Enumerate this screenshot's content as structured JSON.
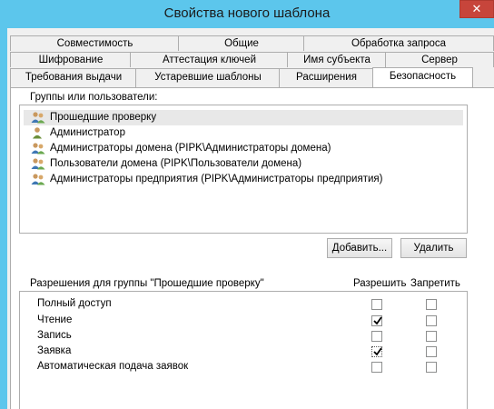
{
  "window": {
    "title": "Свойства нового шаблона",
    "close_glyph": "✕"
  },
  "tabs": {
    "row1": [
      "Совместимость",
      "Общие",
      "Обработка запроса"
    ],
    "row2": [
      "Шифрование",
      "Аттестация ключей",
      "Имя субъекта",
      "Сервер"
    ],
    "row3": [
      "Требования выдачи",
      "Устаревшие шаблоны",
      "Расширения",
      "Безопасность"
    ],
    "active": "Безопасность"
  },
  "groups": {
    "label": "Группы или пользователи:",
    "items": [
      {
        "name": "Прошедшие проверку",
        "icon": "user-group-icon",
        "selected": true
      },
      {
        "name": "Администратор",
        "icon": "user-icon",
        "selected": false
      },
      {
        "name": "Администраторы домена (PIPK\\Администраторы домена)",
        "icon": "user-group-icon",
        "selected": false
      },
      {
        "name": "Пользователи домена (PIPK\\Пользователи домена)",
        "icon": "user-group-icon",
        "selected": false
      },
      {
        "name": "Администраторы предприятия (PIPK\\Администраторы предприятия)",
        "icon": "user-group-icon",
        "selected": false
      }
    ]
  },
  "buttons": {
    "add": "Добавить...",
    "remove": "Удалить"
  },
  "permissions": {
    "label": "Разрешения для группы \"Прошедшие проверку\"",
    "allow_header": "Разрешить",
    "deny_header": "Запретить",
    "rows": [
      {
        "name": "Полный доступ",
        "allow": false,
        "deny": false
      },
      {
        "name": "Чтение",
        "allow": true,
        "deny": false
      },
      {
        "name": "Запись",
        "allow": false,
        "deny": false
      },
      {
        "name": "Заявка",
        "allow": true,
        "deny": false
      },
      {
        "name": "Автоматическая подача заявок",
        "allow": false,
        "deny": false
      }
    ]
  },
  "colors": {
    "titlebar": "#5cc6ec",
    "close": "#c7453b",
    "panel": "#ffffff"
  }
}
